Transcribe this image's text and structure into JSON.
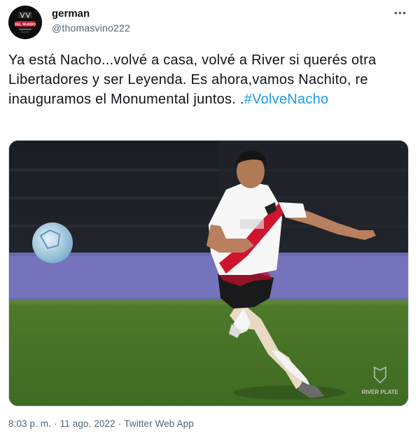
{
  "author": {
    "display_name": "german",
    "handle": "@thomasvino222",
    "avatar_text": "DEL MUNDO"
  },
  "tweet": {
    "text_before_hashtag": "Ya está Nacho...volvé a casa, volvé a River si querés otra Libertadores y ser Leyenda. Es ahora,vamos Nachito, re inauguramos el Monumental juntos. .",
    "hashtag": "#VolveNacho",
    "more_label": "•••"
  },
  "media": {
    "alt_subject": "River Plate player kicking a ball",
    "watermark": "RIVER PLATE"
  },
  "meta": {
    "time": "8:03 p. m.",
    "separator": "·",
    "date": "11 ago. 2022",
    "source": "Twitter Web App"
  },
  "colors": {
    "link": "#1d9bf0",
    "secondary_text": "#536471",
    "primary_text": "#0f1419"
  }
}
